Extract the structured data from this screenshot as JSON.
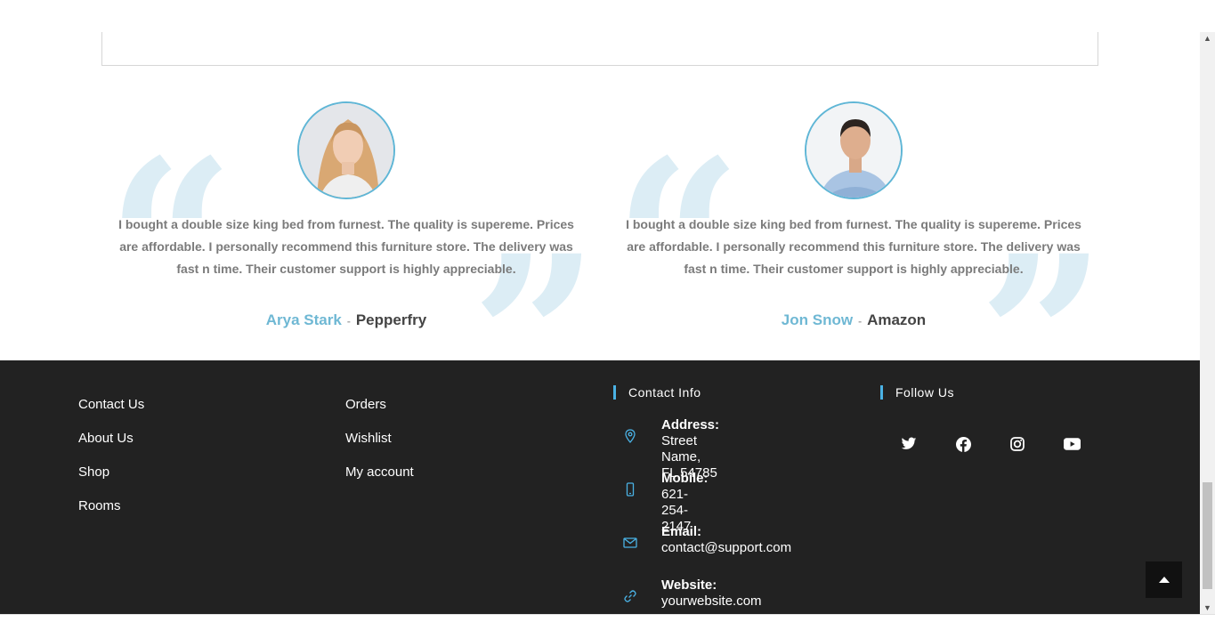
{
  "testimonials": [
    {
      "text": "I bought a double size king bed from furnest. The quality is supereme. Prices are affordable. I personally recommend this furniture store. The delivery was fast n time. Their customer support is highly appreciable.",
      "name": "Arya Stark",
      "separator": "-",
      "company": "Pepperfry"
    },
    {
      "text": "I bought a double size king bed from furnest. The quality is supereme. Prices are affordable. I personally recommend this furniture store. The delivery was fast n time. Their customer support is highly appreciable.",
      "name": "Jon Snow",
      "separator": "-",
      "company": "Amazon"
    }
  ],
  "quote_glyphs": {
    "open": "“",
    "close": "”"
  },
  "footer": {
    "links_col1": [
      "Contact Us",
      "About Us",
      "Shop",
      "Rooms"
    ],
    "links_col2": [
      "Orders",
      "Wishlist",
      "My account"
    ],
    "contact": {
      "title": "Contact Info",
      "items": [
        {
          "icon": "map-pin-icon",
          "label": "Address:",
          "value": "Street Name, FL 54785"
        },
        {
          "icon": "mobile-icon",
          "label": "Mobile:",
          "value": "621-254-2147"
        },
        {
          "icon": "envelope-icon",
          "label": "Email:",
          "value": "contact@support.com"
        },
        {
          "icon": "link-icon",
          "label": "Website:",
          "value": "yourwebsite.com"
        }
      ]
    },
    "follow": {
      "title": "Follow Us",
      "icons": [
        "twitter-icon",
        "facebook-icon",
        "instagram-icon",
        "youtube-icon"
      ]
    }
  },
  "colors": {
    "accent": "#4ab2e5",
    "name_blue": "#6fb8d4",
    "footer_bg": "#222222",
    "quote_bg": "#dcedf5"
  }
}
